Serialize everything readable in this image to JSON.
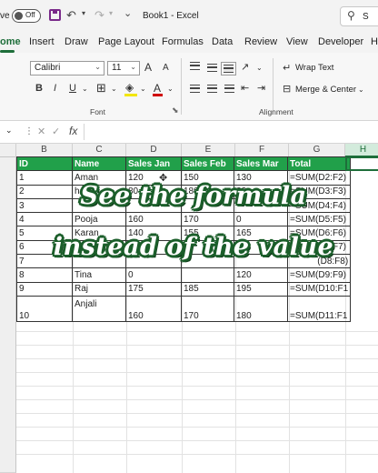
{
  "titlebar": {
    "autosave_suffix": "ve",
    "toggle_label": "Off",
    "doc_title": "Book1 - Excel",
    "search_label": "S"
  },
  "tabs": [
    "ome",
    "Insert",
    "Draw",
    "Page Layout",
    "Formulas",
    "Data",
    "Review",
    "View",
    "Developer",
    "H"
  ],
  "ribbon": {
    "font_name": "Calibri",
    "font_size": "11",
    "font_group_label": "Font",
    "alignment_group_label": "Alignment",
    "wrap_text": "Wrap Text",
    "merge_center": "Merge & Center",
    "bold": "B",
    "italic": "I",
    "underline": "U",
    "grow_font": "A",
    "shrink_font": "A",
    "font_color": "A"
  },
  "formula_bar": {
    "fx_label": "fx"
  },
  "columns": [
    "B",
    "C",
    "D",
    "E",
    "F",
    "G",
    "H"
  ],
  "table": {
    "headers": [
      "ID",
      "Name",
      "Sales Jan",
      "Sales Feb",
      "Sales Mar",
      "Total"
    ],
    "rows": [
      [
        "1",
        "Aman",
        "120",
        "150",
        "130",
        "=SUM(D2:F2)"
      ],
      [
        "2",
        "ha",
        "80",
        "180",
        "22",
        "=SUM(D3:F3)"
      ],
      [
        "3",
        "",
        "",
        "",
        "",
        "=SUM(D4:F4)"
      ],
      [
        "4",
        "Pooja",
        "160",
        "170",
        "0",
        "=SUM(D5:F5)"
      ],
      [
        "5",
        "Karan",
        "140",
        "155",
        "165",
        "=SUM(D6:F6)"
      ],
      [
        "6",
        "Sita",
        "180",
        "",
        "",
        "=SUM(D7:F7)"
      ],
      [
        "7",
        "",
        "",
        "",
        "",
        "(D8:F8)"
      ],
      [
        "8",
        "Tina",
        "0",
        "",
        "120",
        "=SUM(D9:F9)"
      ],
      [
        "9",
        "Raj",
        "175",
        "185",
        "195",
        "=SUM(D10:F1"
      ],
      [
        "10",
        "Anjali",
        "160",
        "170",
        "180",
        "=SUM(D11:F1"
      ]
    ]
  },
  "caption": {
    "line1": "See the formula",
    "line2": "instead of the value"
  },
  "colors": {
    "header_green": "#21a04a",
    "excel_green": "#1e6e3a",
    "caption_outline": "#1b5e2a"
  }
}
